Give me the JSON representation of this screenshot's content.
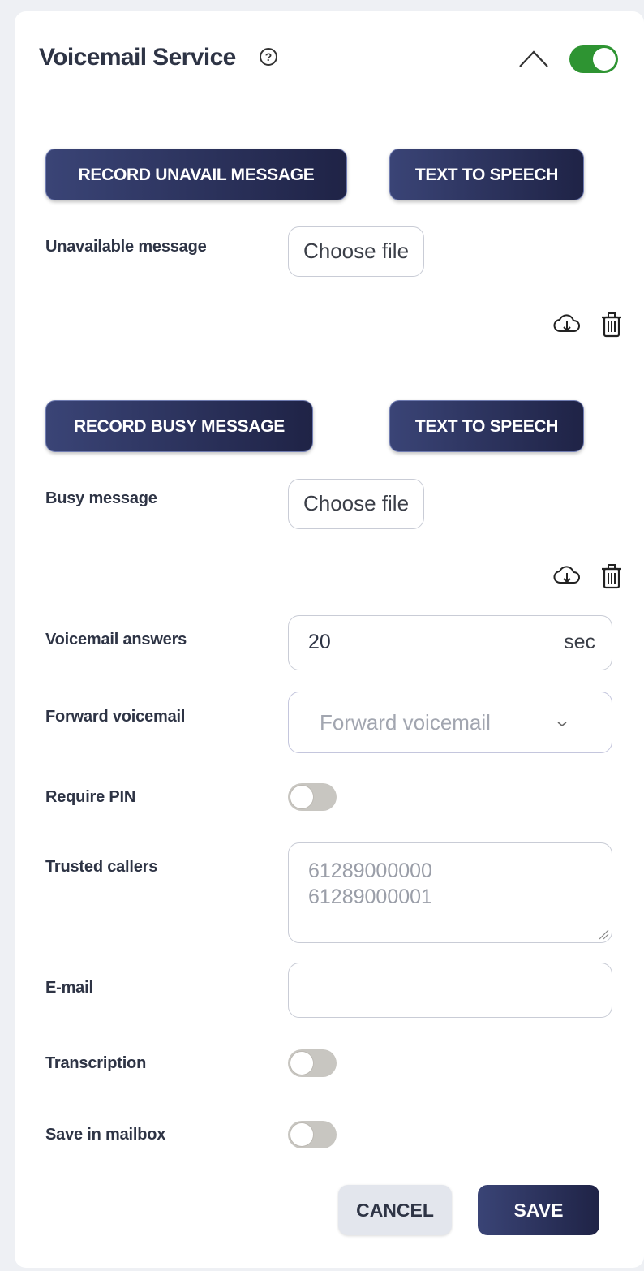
{
  "header": {
    "title": "Voicemail Service",
    "help_icon": "?",
    "collapse_icon": "chevron-up-icon",
    "service_enabled": true
  },
  "unavailable": {
    "record_label": "RECORD UNAVAIL MESSAGE",
    "tts_label": "TEXT TO SPEECH",
    "field_label": "Unavailable message",
    "file_button": "Choose file"
  },
  "busy": {
    "record_label": "RECORD BUSY MESSAGE",
    "tts_label": "TEXT TO SPEECH",
    "field_label": "Busy message",
    "file_button": "Choose file"
  },
  "form": {
    "voicemail_answers_label": "Voicemail answers",
    "voicemail_answers_value": "20",
    "voicemail_answers_unit": "sec",
    "forward_label": "Forward voicemail",
    "forward_placeholder": "Forward voicemail",
    "require_pin_label": "Require PIN",
    "require_pin_enabled": false,
    "trusted_label": "Trusted callers",
    "trusted_placeholder_line1": "61289000000",
    "trusted_placeholder_line2": "61289000001",
    "email_label": "E-mail",
    "email_value": "",
    "transcription_label": "Transcription",
    "transcription_enabled": false,
    "save_mailbox_label": "Save in mailbox",
    "save_mailbox_enabled": false
  },
  "actions": {
    "cancel_label": "CANCEL",
    "save_label": "SAVE"
  },
  "colors": {
    "toggle_on": "#2e9432",
    "toggle_off": "#c8c6c1",
    "primary_button": "#2a3060"
  }
}
